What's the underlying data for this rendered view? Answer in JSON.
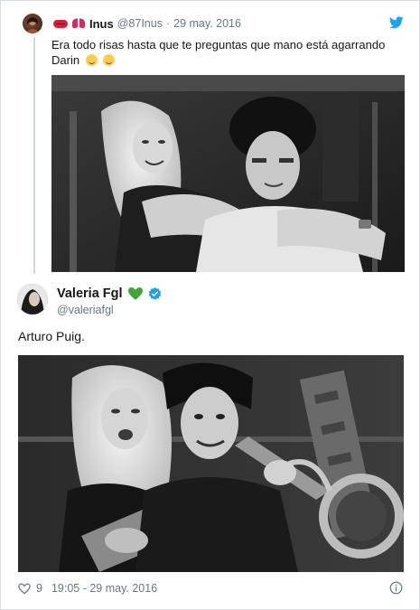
{
  "quoted_tweet": {
    "name": "Inus",
    "handle": "@87Inus",
    "separator": "·",
    "date": "29 may. 2016",
    "text": "Era todo risas hasta que te preguntas que mano está agarrando Darin",
    "name_emojis": [
      "lips-icon",
      "bow-icon"
    ],
    "text_emojis": [
      "upside-down-face-icon",
      "tears-of-joy-icon"
    ],
    "brand_color": "#1da1f2"
  },
  "main_tweet": {
    "name": "Valeria Fgl",
    "handle": "@valeriafgl",
    "text": "Arturo Puig.",
    "time": "19:05 - 29 may. 2016",
    "likes": "9",
    "verified_color": "#1da1f2",
    "heart_color": "#3fa535"
  }
}
